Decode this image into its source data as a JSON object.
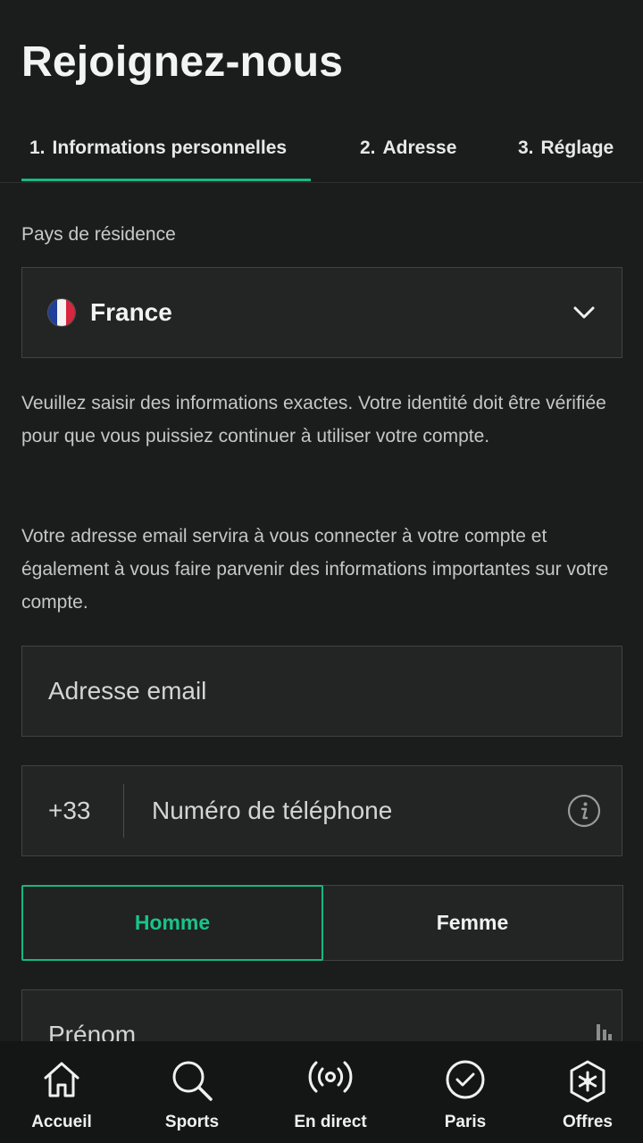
{
  "header": {
    "title": "Rejoignez-nous"
  },
  "tabs": [
    {
      "num": "1.",
      "label": "Informations personnelles"
    },
    {
      "num": "2.",
      "label": "Adresse"
    },
    {
      "num": "3.",
      "label": "Réglage"
    }
  ],
  "form": {
    "country_label": "Pays de résidence",
    "country_value": "France",
    "info_text_1": "Veuillez saisir des informations exactes. Votre identité doit être vérifiée pour que vous puissiez continuer à utiliser votre compte.",
    "info_text_2": "Votre adresse email servira à vous connecter à votre compte et également à vous faire parvenir des informations importantes sur votre compte.",
    "email_placeholder": "Adresse email",
    "phone_prefix": "+33",
    "phone_placeholder": "Numéro de téléphone",
    "gender_options": [
      "Homme",
      "Femme"
    ],
    "gender_selected": "Homme",
    "firstname_placeholder": "Prénom"
  },
  "bottom_nav": [
    {
      "label": "Accueil",
      "icon": "home-icon"
    },
    {
      "label": "Sports",
      "icon": "search-icon"
    },
    {
      "label": "En direct",
      "icon": "live-broadcast-icon"
    },
    {
      "label": "Paris",
      "icon": "check-circle-icon"
    },
    {
      "label": "Offres",
      "icon": "offers-star-icon"
    }
  ],
  "colors": {
    "accent": "#16b97f",
    "background": "#1b1d1c",
    "field_background": "#232524"
  }
}
